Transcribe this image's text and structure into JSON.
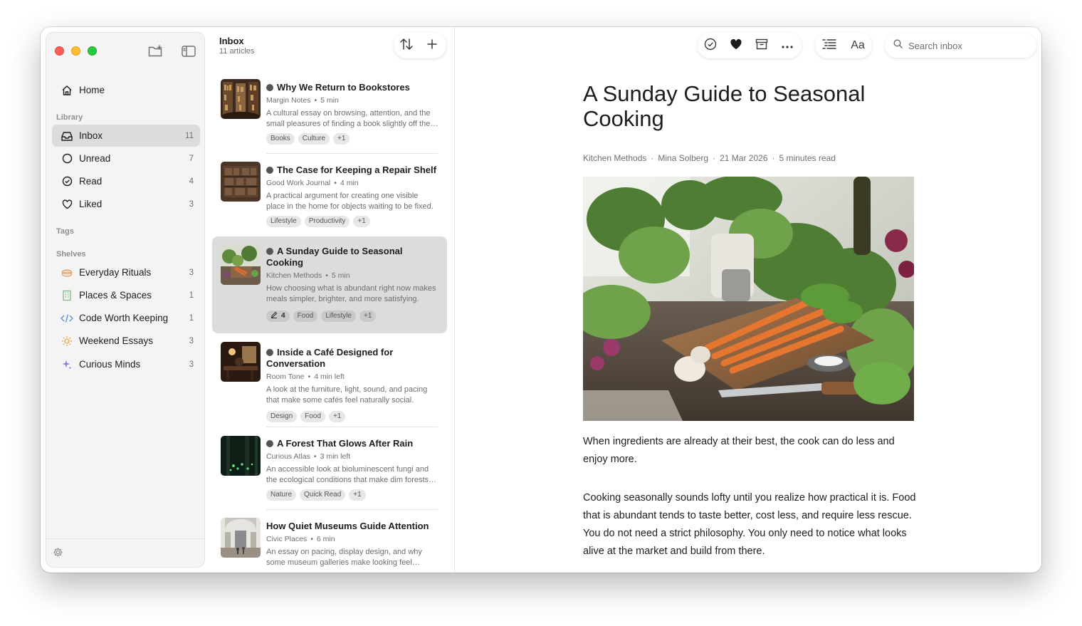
{
  "sidebar": {
    "nav": [
      {
        "label": "Home",
        "icon": "home-icon"
      }
    ],
    "library_label": "Library",
    "library": [
      {
        "label": "Inbox",
        "count": "11",
        "icon": "inbox-icon"
      },
      {
        "label": "Unread",
        "count": "7",
        "icon": "circle-icon"
      },
      {
        "label": "Read",
        "count": "4",
        "icon": "check-circle-icon"
      },
      {
        "label": "Liked",
        "count": "3",
        "icon": "heart-icon"
      }
    ],
    "tags_label": "Tags",
    "shelves_label": "Shelves",
    "shelves": [
      {
        "label": "Everyday Rituals",
        "count": "3",
        "icon": "cup-icon",
        "color": "#e0a46c"
      },
      {
        "label": "Places & Spaces",
        "count": "1",
        "icon": "building-icon",
        "color": "#7fb88a"
      },
      {
        "label": "Code Worth Keeping",
        "count": "1",
        "icon": "code-icon",
        "color": "#5b8fd6"
      },
      {
        "label": "Weekend Essays",
        "count": "3",
        "icon": "sun-icon",
        "color": "#e5a23a"
      },
      {
        "label": "Curious Minds",
        "count": "3",
        "icon": "sparkle-icon",
        "color": "#8a7be0"
      }
    ]
  },
  "list": {
    "title": "Inbox",
    "subtitle": "11 articles",
    "articles": [
      {
        "title": "Why We Return to Bookstores",
        "source": "Margin Notes",
        "time": "5 min",
        "desc": "A cultural essay on browsing, attention, and the small pleasures of finding a book slightly off the path you came in on.",
        "tags": [
          "Books",
          "Culture",
          "+1"
        ]
      },
      {
        "title": "The Case for Keeping a Repair Shelf",
        "source": "Good Work Journal",
        "time": "4 min",
        "desc": "A practical argument for creating one visible place in the home for objects waiting to be fixed.",
        "tags": [
          "Lifestyle",
          "Productivity",
          "+1"
        ]
      },
      {
        "title": "A Sunday Guide to Seasonal Cooking",
        "source": "Kitchen Methods",
        "time": "5 min",
        "desc": "How choosing what is abundant right now makes meals simpler, brighter, and more satisfying.",
        "highlights": "4",
        "tags": [
          "Food",
          "Lifestyle",
          "+1"
        ]
      },
      {
        "title": "Inside a Café Designed for Conversation",
        "source": "Room Tone",
        "time": "4 min left",
        "desc": "A look at the furniture, light, sound, and pacing that make some cafés feel naturally social.",
        "tags": [
          "Design",
          "Food",
          "+1"
        ]
      },
      {
        "title": "A Forest That Glows After Rain",
        "source": "Curious Atlas",
        "time": "3 min left",
        "desc": "An accessible look at bioluminescent fungi and the ecological conditions that make dim forests glow.",
        "tags": [
          "Nature",
          "Quick Read",
          "+1"
        ]
      },
      {
        "title": "How Quiet Museums Guide Attention",
        "source": "Civic Places",
        "time": "6 min",
        "desc": "An essay on pacing, display design, and why some museum galleries make looking feel effortless.",
        "tags": []
      }
    ]
  },
  "toolbar": {
    "search_placeholder": "Search inbox",
    "font_label": "Aa"
  },
  "article": {
    "title": "A Sunday Guide to Seasonal Cooking",
    "source": "Kitchen Methods",
    "author": "Mina Solberg",
    "date": "21 Mar 2026",
    "read_time": "5 minutes read",
    "p1": "When ingredients are already at their best, the cook can do less and enjoy more.",
    "p2": "Cooking seasonally sounds lofty until you realize how practical it is. Food that is abundant tends to taste better, cost less, and require less rescue. You do not need a strict philosophy. You only need to notice what looks alive at the market and build from there."
  }
}
